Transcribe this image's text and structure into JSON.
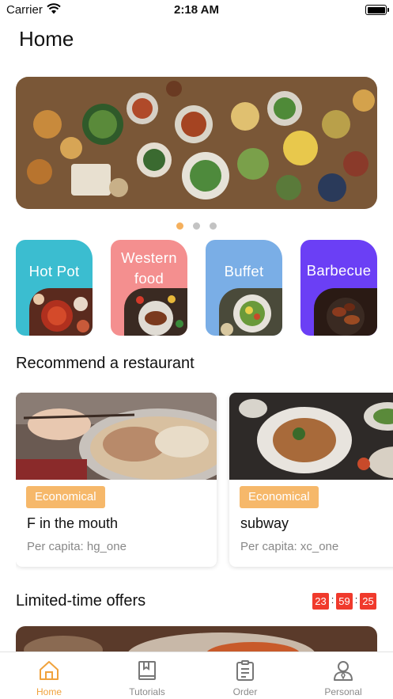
{
  "status_bar": {
    "carrier": "Carrier",
    "time": "2:18 AM"
  },
  "page_title": "Home",
  "banner": {
    "dots": 3,
    "active_dot": 0
  },
  "categories": [
    {
      "label": "Hot Pot",
      "color": "#3bbdd0"
    },
    {
      "label": "Western food",
      "color": "#f48f8f"
    },
    {
      "label": "Buffet",
      "color": "#7aaee6"
    },
    {
      "label": "Barbecue",
      "color": "#6b3ff5"
    }
  ],
  "recommend": {
    "title": "Recommend a restaurant",
    "items": [
      {
        "tag": "Economical",
        "name": "F in the mouth",
        "per_capita": "Per capita: hg_one"
      },
      {
        "tag": "Economical",
        "name": "subway",
        "per_capita": "Per capita: xc_one"
      }
    ]
  },
  "offers": {
    "title": "Limited-time offers",
    "countdown": {
      "hours": "23",
      "minutes": "59",
      "seconds": "25"
    }
  },
  "tabbar": {
    "items": [
      {
        "label": "Home",
        "icon": "home-icon",
        "active": true
      },
      {
        "label": "Tutorials",
        "icon": "book-icon",
        "active": false
      },
      {
        "label": "Order",
        "icon": "clipboard-icon",
        "active": false
      },
      {
        "label": "Personal",
        "icon": "person-icon",
        "active": false
      }
    ]
  },
  "colors": {
    "accent": "#f0a23c",
    "tag": "#f6b86a",
    "countdown": "#f03a2c",
    "dot_active": "#f5b05d"
  }
}
